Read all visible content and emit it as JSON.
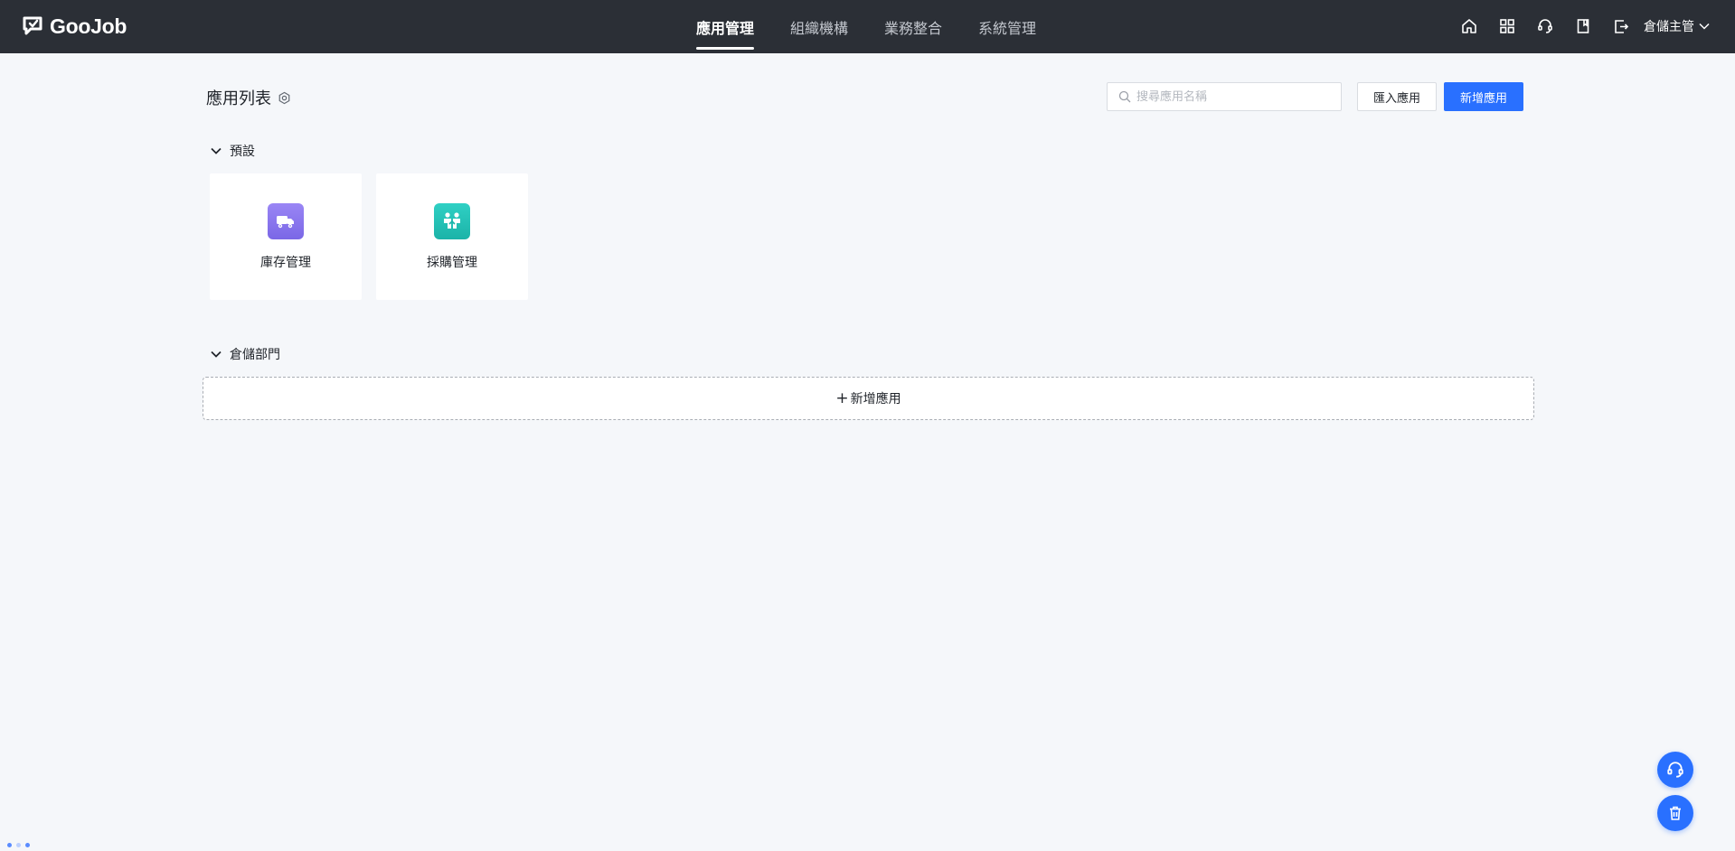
{
  "brand": {
    "name": "GooJob"
  },
  "nav": {
    "tabs": [
      {
        "label": "應用管理",
        "active": true
      },
      {
        "label": "組織機構",
        "active": false
      },
      {
        "label": "業務整合",
        "active": false
      },
      {
        "label": "系統管理",
        "active": false
      }
    ]
  },
  "header_icons": [
    "home-icon",
    "apps-grid-icon",
    "headset-icon",
    "book-icon",
    "export-icon"
  ],
  "user": {
    "name": "倉儲主管"
  },
  "page": {
    "title": "應用列表",
    "search_placeholder": "搜尋應用名稱",
    "import_label": "匯入應用",
    "new_label": "新增應用"
  },
  "groups": [
    {
      "name": "預設",
      "apps": [
        {
          "name": "庫存管理",
          "icon": "truck-icon",
          "color": "#8a78ee"
        },
        {
          "name": "採購管理",
          "icon": "handshake-people-icon",
          "color": "#24c1b6"
        }
      ]
    },
    {
      "name": "倉儲部門",
      "add_label": "新增應用"
    }
  ],
  "colors": {
    "topbar": "#2b2f36",
    "accent": "#2970ff",
    "background": "#f5f7fa"
  }
}
